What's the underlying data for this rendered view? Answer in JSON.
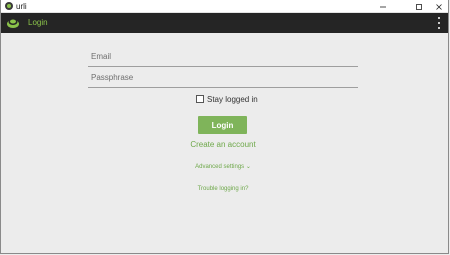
{
  "window": {
    "title": "urli"
  },
  "appbar": {
    "title": "Login"
  },
  "form": {
    "email_placeholder": "Email",
    "email_value": "",
    "passphrase_placeholder": "Passphrase",
    "passphrase_value": "",
    "stay_logged_in_label": "Stay logged in",
    "stay_logged_in_checked": false,
    "login_label": "Login",
    "create_account_label": "Create an account",
    "advanced_settings_label": "Advanced settings ⌄",
    "trouble_label": "Trouble logging in?"
  },
  "colors": {
    "accent": "#7fb45a",
    "appbar_bg": "#252525",
    "page_bg": "#ececec"
  },
  "icons": [
    "app-icon",
    "logo-icon",
    "minimize-icon",
    "maximize-icon",
    "close-icon",
    "more-vert-icon"
  ]
}
